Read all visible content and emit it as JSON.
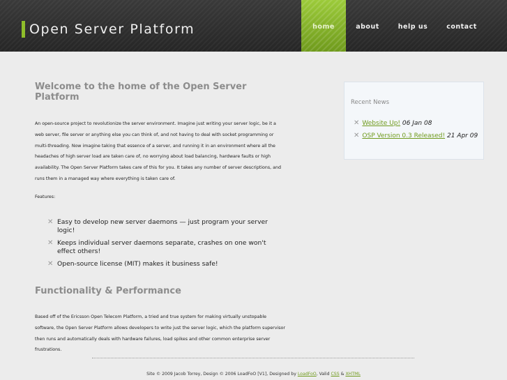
{
  "header": {
    "brand": "Open Server Platform",
    "accent_color": "#8fbe2a",
    "nav": [
      {
        "label": "home",
        "active": true
      },
      {
        "label": "about"
      },
      {
        "label": "help us"
      },
      {
        "label": "contact"
      }
    ]
  },
  "main": {
    "welcome_title": "Welcome to the home of the Open Server Platform",
    "intro": "An open-source project to revolutionize the server environment. Imagine just writing your server logic, be it a web server, file server or anything else you can think of, and not having to deal with socket programming or multi-threading. Now imagine taking that essence of a server, and running it in an environment where all the headaches of high server load are taken care of, no worrying about load balancing, hardware faults or high availability. The Open Server Platform takes care of this for you. It takes any number of server descriptions, and runs them in a managed way where everything is taken care of.",
    "features_label": "Features:",
    "features": [
      "Easy to develop new server daemons — just program your server logic!",
      "Keeps individual server daemons separate, crashes on one won't effect others!",
      "Open-source license (MIT) makes it business safe!"
    ],
    "functionality_title": "Functionality & Performance",
    "functionality_text": "Based off of the Ericsson Open Telecom Platform, a tried and true system for making virtually unstopable software, the Open Server Platform allows developers to write just the server logic, which the platform supervisor then runs and automatically deals with hardware failures, load spikes and other common enterprise server frustrations."
  },
  "sidebar": {
    "title": "Recent News",
    "news": [
      {
        "link": "Website Up!",
        "date": "06 Jan 08"
      },
      {
        "link": "OSP Version 0.3 Released!",
        "date": "21 Apr 09"
      }
    ]
  },
  "footer": {
    "prefix": "Site © 2009 Jacob Torrey, Design © 2006 LoadFoO [V1], Designed by",
    "designer_link": "LoadFoO",
    "valid_text": ", Valid",
    "css_link": "CSS",
    "amp": "&",
    "xhtml_link": "XHTML"
  }
}
